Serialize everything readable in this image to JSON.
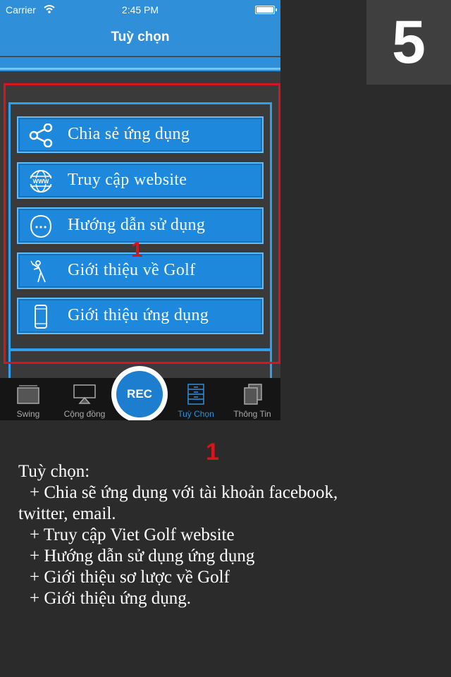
{
  "status_bar": {
    "carrier": "Carrier",
    "time": "2:45 PM"
  },
  "nav": {
    "title": "Tuỳ chọn"
  },
  "menu": {
    "items": [
      {
        "label": "Chia sẻ ứng dụng",
        "icon": "share-icon"
      },
      {
        "label": "Truy cập website",
        "icon": "globe-www-icon"
      },
      {
        "label": "Hướng dẫn sử dụng",
        "icon": "help-chat-icon"
      },
      {
        "label": "Giới thiệu về Golf",
        "icon": "golfer-icon"
      },
      {
        "label": "Giới thiệu ứng dụng",
        "icon": "phone-icon"
      }
    ]
  },
  "annotation_number": "1",
  "tabbar": {
    "tabs": [
      {
        "label": "Swing",
        "icon": "swing-icon",
        "active": false
      },
      {
        "label": "Cộng đồng",
        "icon": "airplay-icon",
        "active": false
      },
      {
        "label": "Tuỳ Chọn",
        "icon": "options-icon",
        "active": true
      },
      {
        "label": "Thông Tin",
        "icon": "info-stack-icon",
        "active": false
      }
    ],
    "rec_label": "REC"
  },
  "step_number": "5",
  "description": {
    "number": "1",
    "heading": "Tuỳ chọn:",
    "lines": [
      "+ Chia sẽ ứng dụng với tài khoản facebook,",
      "twitter, email.",
      "+ Truy cập Viet Golf website",
      "+ Hướng dẫn sử dụng ứng dụng",
      "+ Giới thiệu sơ lược về Golf",
      "+ Giới thiệu ứng dụng."
    ]
  },
  "colors": {
    "accent": "#2f8fd8",
    "highlight": "#d8141c",
    "button": "#1e88dd"
  }
}
